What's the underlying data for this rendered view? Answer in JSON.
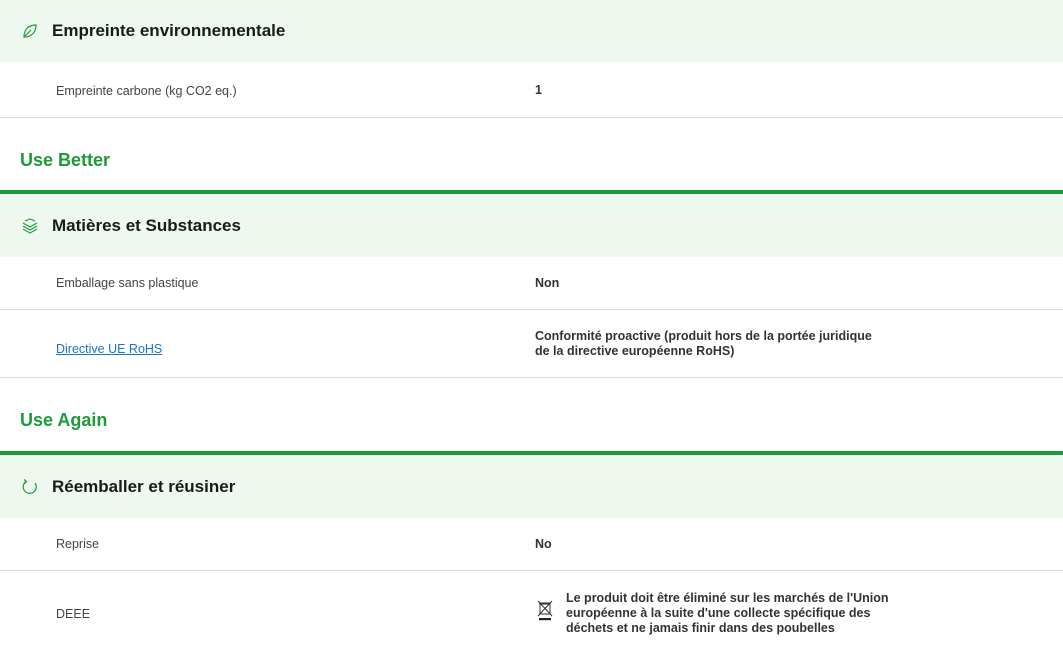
{
  "sections": {
    "env": {
      "title": "Empreinte environnementale",
      "icon": "leaf-icon",
      "rows": [
        {
          "label": "Empreinte carbone (kg CO2 eq.)",
          "value": "1"
        }
      ]
    },
    "use_better": {
      "group_title": "Use Better",
      "title": "Matières et Substances",
      "icon": "layers-icon",
      "rows": [
        {
          "label": "Emballage sans plastique",
          "value": "Non"
        },
        {
          "label": "Directive UE RoHS",
          "value_line1": "Conformité proactive (produit hors de la portée juridique",
          "value_line2": "de la directive européenne RoHS)"
        }
      ]
    },
    "use_again": {
      "group_title": "Use Again",
      "title": "Réemballer et réusiner",
      "icon": "refresh-icon",
      "rows": [
        {
          "label": "Reprise",
          "value": "No"
        },
        {
          "label": "DEEE",
          "value_line1": "Le produit doit être éliminé sur les marchés de l'Union",
          "value_line2": "européenne à la suite d'une collecte spécifique des",
          "value_line3": "déchets et ne jamais finir dans des poubelles"
        }
      ]
    }
  },
  "colors": {
    "accent": "#1d9a3a",
    "header_bg": "#eef8ef",
    "link": "#1a73c9"
  }
}
